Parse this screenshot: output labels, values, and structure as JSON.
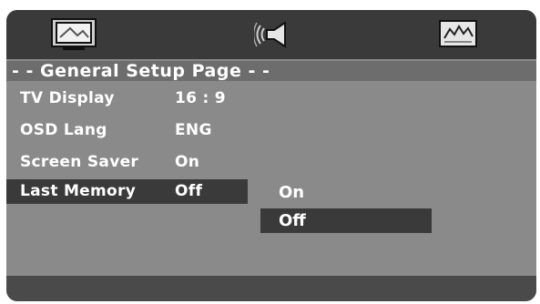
{
  "tabs": [
    {
      "icon": "tv-icon"
    },
    {
      "icon": "speaker-icon"
    },
    {
      "icon": "preferences-icon"
    }
  ],
  "page_title": "- - General Setup Page - -",
  "settings": [
    {
      "label": "TV Display",
      "value": "16 : 9"
    },
    {
      "label": "OSD Lang",
      "value": "ENG"
    },
    {
      "label": "Screen Saver",
      "value": "On"
    },
    {
      "label": "Last Memory",
      "value": "Off"
    }
  ],
  "submenu": [
    "On",
    "Off"
  ],
  "selected_setting": "Last Memory",
  "selected_option": "Off",
  "colors": {
    "background": "#8a8a8a",
    "highlight": "#3a3a3a",
    "title_bar": "#6d6d6d",
    "text": "#ffffff"
  }
}
